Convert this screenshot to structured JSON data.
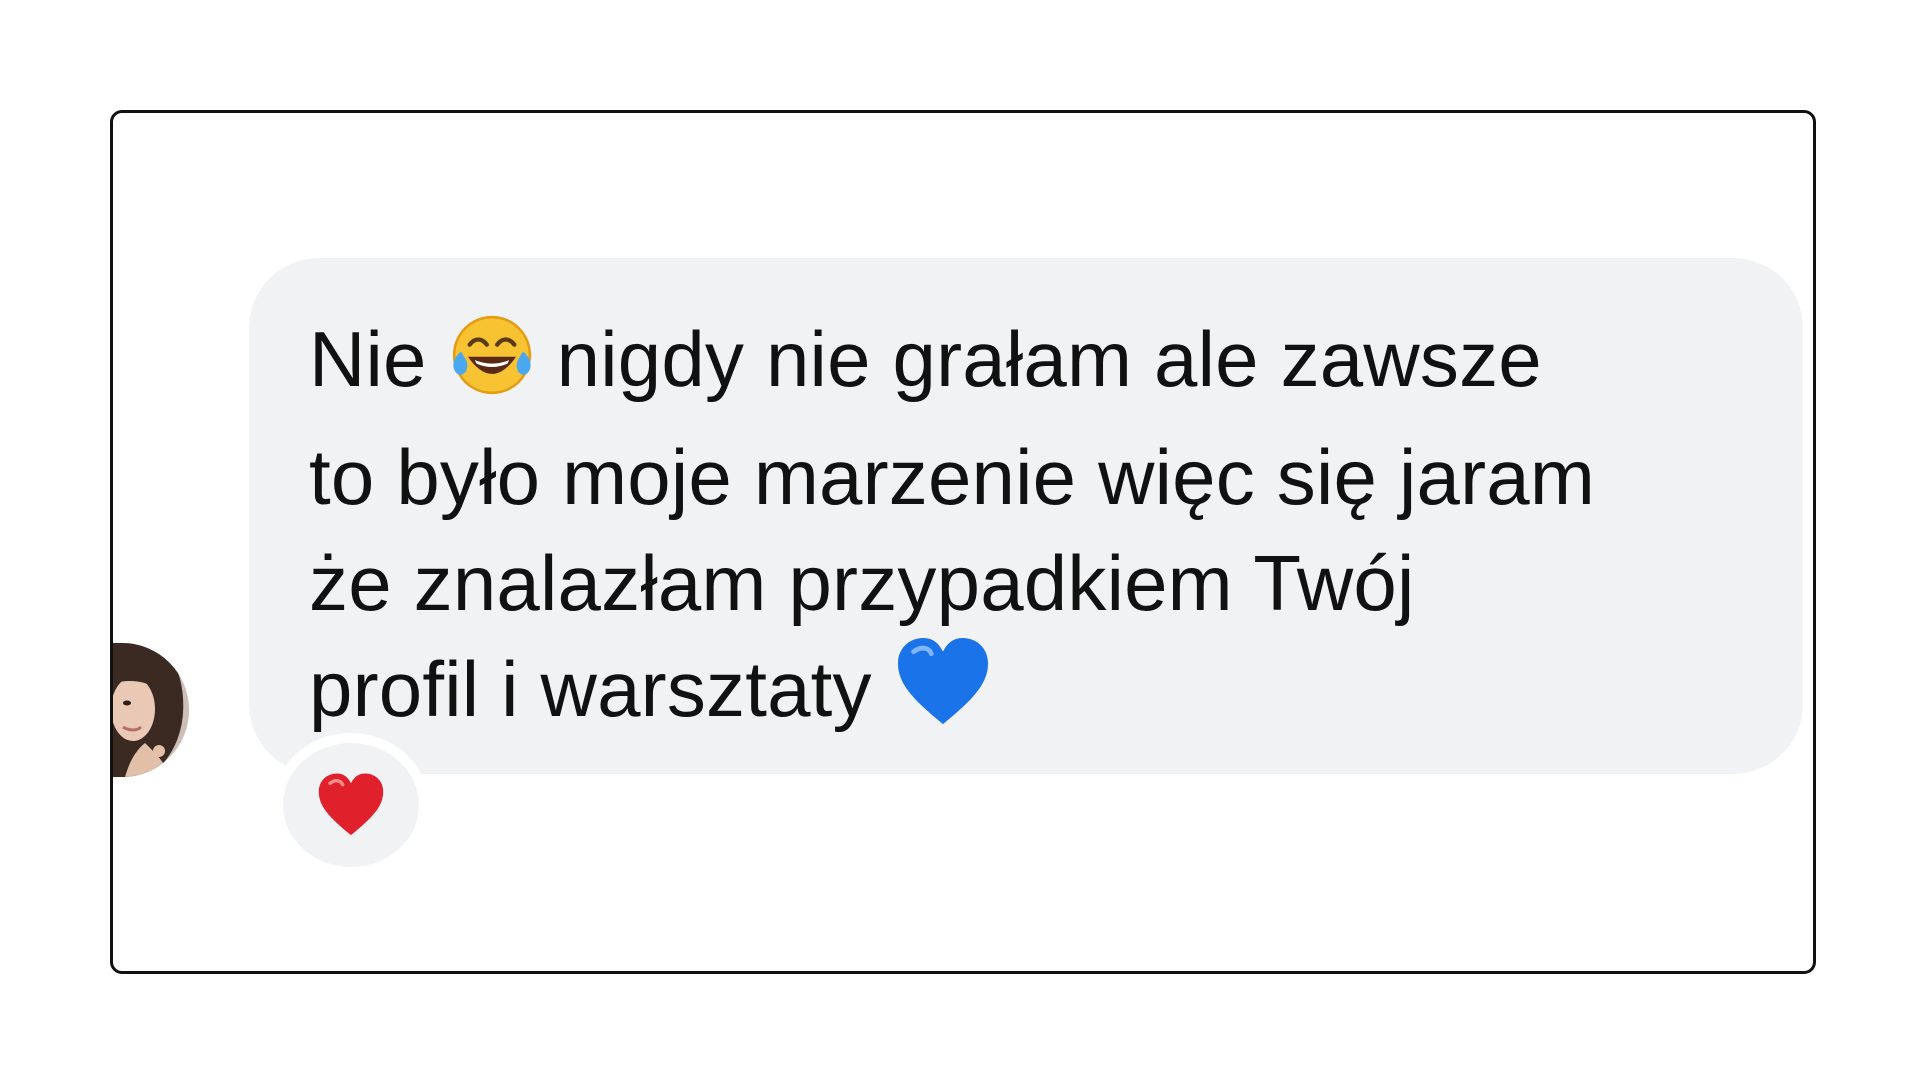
{
  "message": {
    "segments": [
      "Nie",
      "nigdy nie grałam ale zawsze",
      "to było moje marzenie więc się jaram",
      "że znalazłam przypadkiem Twój",
      "profil i warsztaty"
    ],
    "emojis": {
      "inline_1": "face-with-tears-of-joy-icon",
      "inline_2": "blue-heart-icon"
    }
  },
  "reaction": {
    "icon": "red-heart-icon",
    "color": "#e0202a"
  },
  "colors": {
    "bubble_background": "#f1f2f4",
    "text": "#111111",
    "frame_border": "#111111"
  }
}
